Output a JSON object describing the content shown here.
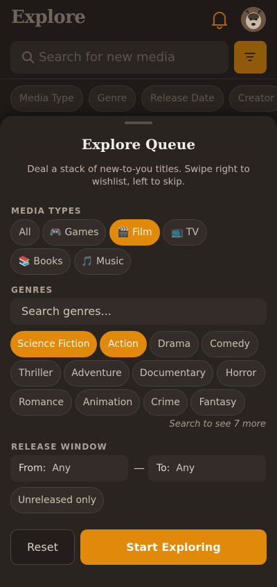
{
  "header": {
    "title": "Explore",
    "icons": {
      "notifications": "bell-icon",
      "avatar": "user-avatar-dog"
    }
  },
  "search": {
    "placeholder": "Search for new media"
  },
  "filter_chips": [
    "Media Type",
    "Genre",
    "Release Date",
    "Creator"
  ],
  "sheet": {
    "title": "Explore Queue",
    "description": "Deal a stack of new-to-you titles. Swipe right to wishlist, left to skip.",
    "media_types_label": "MEDIA TYPES",
    "media_types": [
      {
        "label": "All",
        "icon": "",
        "selected": false
      },
      {
        "label": "Games",
        "icon": "🎮",
        "selected": false
      },
      {
        "label": "Film",
        "icon": "🎬",
        "selected": true
      },
      {
        "label": "TV",
        "icon": "📺",
        "selected": false
      },
      {
        "label": "Books",
        "icon": "📚",
        "selected": false
      },
      {
        "label": "Music",
        "icon": "🎵",
        "selected": false
      }
    ],
    "genres_label": "GENRES",
    "genre_search_placeholder": "Search genres...",
    "genres": [
      {
        "label": "Science Fiction",
        "selected": true
      },
      {
        "label": "Action",
        "selected": true
      },
      {
        "label": "Drama",
        "selected": false
      },
      {
        "label": "Comedy",
        "selected": false
      },
      {
        "label": "Thriller",
        "selected": false
      },
      {
        "label": "Adventure",
        "selected": false
      },
      {
        "label": "Documentary",
        "selected": false
      },
      {
        "label": "Horror",
        "selected": false
      },
      {
        "label": "Romance",
        "selected": false
      },
      {
        "label": "Animation",
        "selected": false
      },
      {
        "label": "Crime",
        "selected": false
      },
      {
        "label": "Fantasy",
        "selected": false
      }
    ],
    "more_genres_hint": "Search to see 7 more",
    "release_label": "RELEASE WINDOW",
    "from_label": "From:",
    "from_value": "Any",
    "range_dash": "—",
    "to_label": "To:",
    "to_value": "Any",
    "unreleased_label": "Unreleased only",
    "reset_label": "Reset",
    "start_label": "Start Exploring"
  },
  "colors": {
    "accent": "#e0890a",
    "background": "#1f1a17",
    "sheet": "#2a2421"
  }
}
